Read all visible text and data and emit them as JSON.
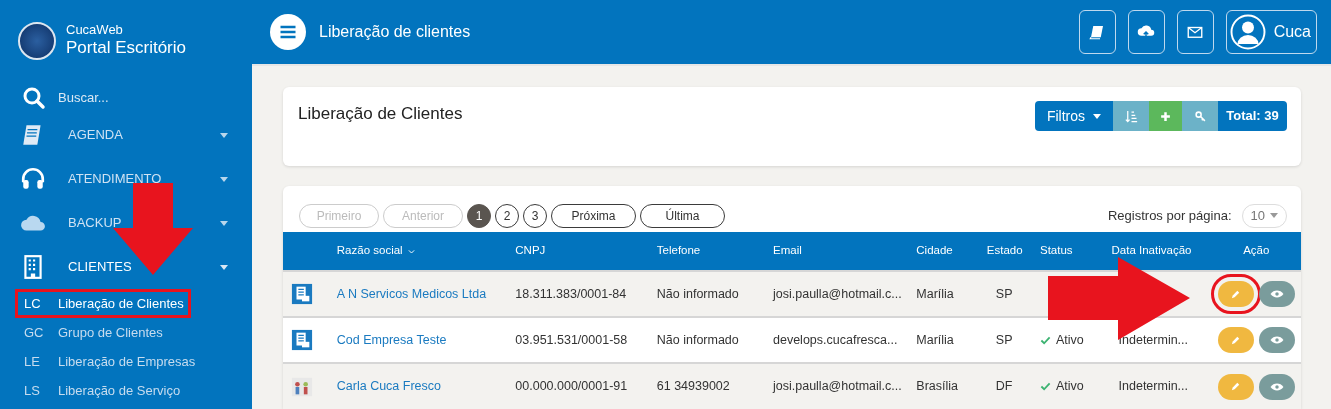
{
  "brand": {
    "small": "CucaWeb",
    "title": "Portal Escritório"
  },
  "search": {
    "placeholder": "Buscar..."
  },
  "menu": [
    {
      "label": "AGENDA",
      "kind": "book",
      "expanded": false
    },
    {
      "label": "ATENDIMENTO",
      "kind": "headset",
      "expanded": false
    },
    {
      "label": "BACKUP",
      "kind": "cloud",
      "expanded": false
    },
    {
      "label": "CLIENTES",
      "kind": "building",
      "expanded": true
    }
  ],
  "subitems": [
    {
      "abbr": "LC",
      "label": "Liberação de Clientes",
      "selected": true,
      "highlighted": true
    },
    {
      "abbr": "GC",
      "label": "Grupo de Clientes",
      "selected": false,
      "highlighted": false
    },
    {
      "abbr": "LE",
      "label": "Liberação de Empresas",
      "selected": false,
      "highlighted": false
    },
    {
      "abbr": "LS",
      "label": "Liberação de Serviço",
      "selected": false,
      "highlighted": false
    }
  ],
  "topbar": {
    "title": "Liberação de clientes",
    "user": "Cuca"
  },
  "page": {
    "title": "Liberação de Clientes",
    "filter_label": "Filtros",
    "total": "Total: 39"
  },
  "pagination": [
    {
      "label": "Primeiro",
      "kind": "pill",
      "disabled": true,
      "selected": false
    },
    {
      "label": "Anterior",
      "kind": "pill",
      "disabled": true,
      "selected": false
    },
    {
      "label": "1",
      "kind": "page",
      "disabled": false,
      "selected": true
    },
    {
      "label": "2",
      "kind": "page",
      "disabled": false,
      "selected": false
    },
    {
      "label": "3",
      "kind": "page",
      "disabled": false,
      "selected": false
    },
    {
      "label": "Próxima",
      "kind": "pill",
      "disabled": false,
      "selected": false
    },
    {
      "label": "Última",
      "kind": "pill",
      "disabled": false,
      "selected": false
    }
  ],
  "per_page": {
    "label": "Registros por página:",
    "value": "10"
  },
  "table": {
    "columns": [
      "Razão social",
      "CNPJ",
      "Telefone",
      "Email",
      "Cidade",
      "Estado",
      "Status",
      "Data Inativação",
      "Ação"
    ],
    "rows": [
      {
        "kind": "building",
        "name": "A N Servicos Medicos Ltda",
        "cnpj": "18.311.383/0001-84",
        "phone": "Não informado",
        "email": "josi.paulla@hotmail.c...",
        "city": "Marília",
        "state": "SP",
        "edit_highlighted": true
      },
      {
        "kind": "building",
        "name": "Cod Empresa Teste",
        "cnpj": "03.951.531/0001-58",
        "phone": "Não informado",
        "email": "develops.cucafresca...",
        "city": "Marília",
        "state": "SP",
        "status": "Ativo",
        "inactivation": "Indetermin...",
        "edit_highlighted": false
      },
      {
        "kind": "people",
        "name": "Carla Cuca Fresco",
        "cnpj": "00.000.000/0001-91",
        "phone": "61 34939002",
        "email": "josi.paulla@hotmail.c...",
        "city": "Brasília",
        "state": "DF",
        "status": "Ativo",
        "inactivation": "Indetermin...",
        "edit_highlighted": false
      }
    ]
  },
  "annotations": [
    {
      "kind": "arrow-down"
    },
    {
      "kind": "arrow-right"
    }
  ]
}
